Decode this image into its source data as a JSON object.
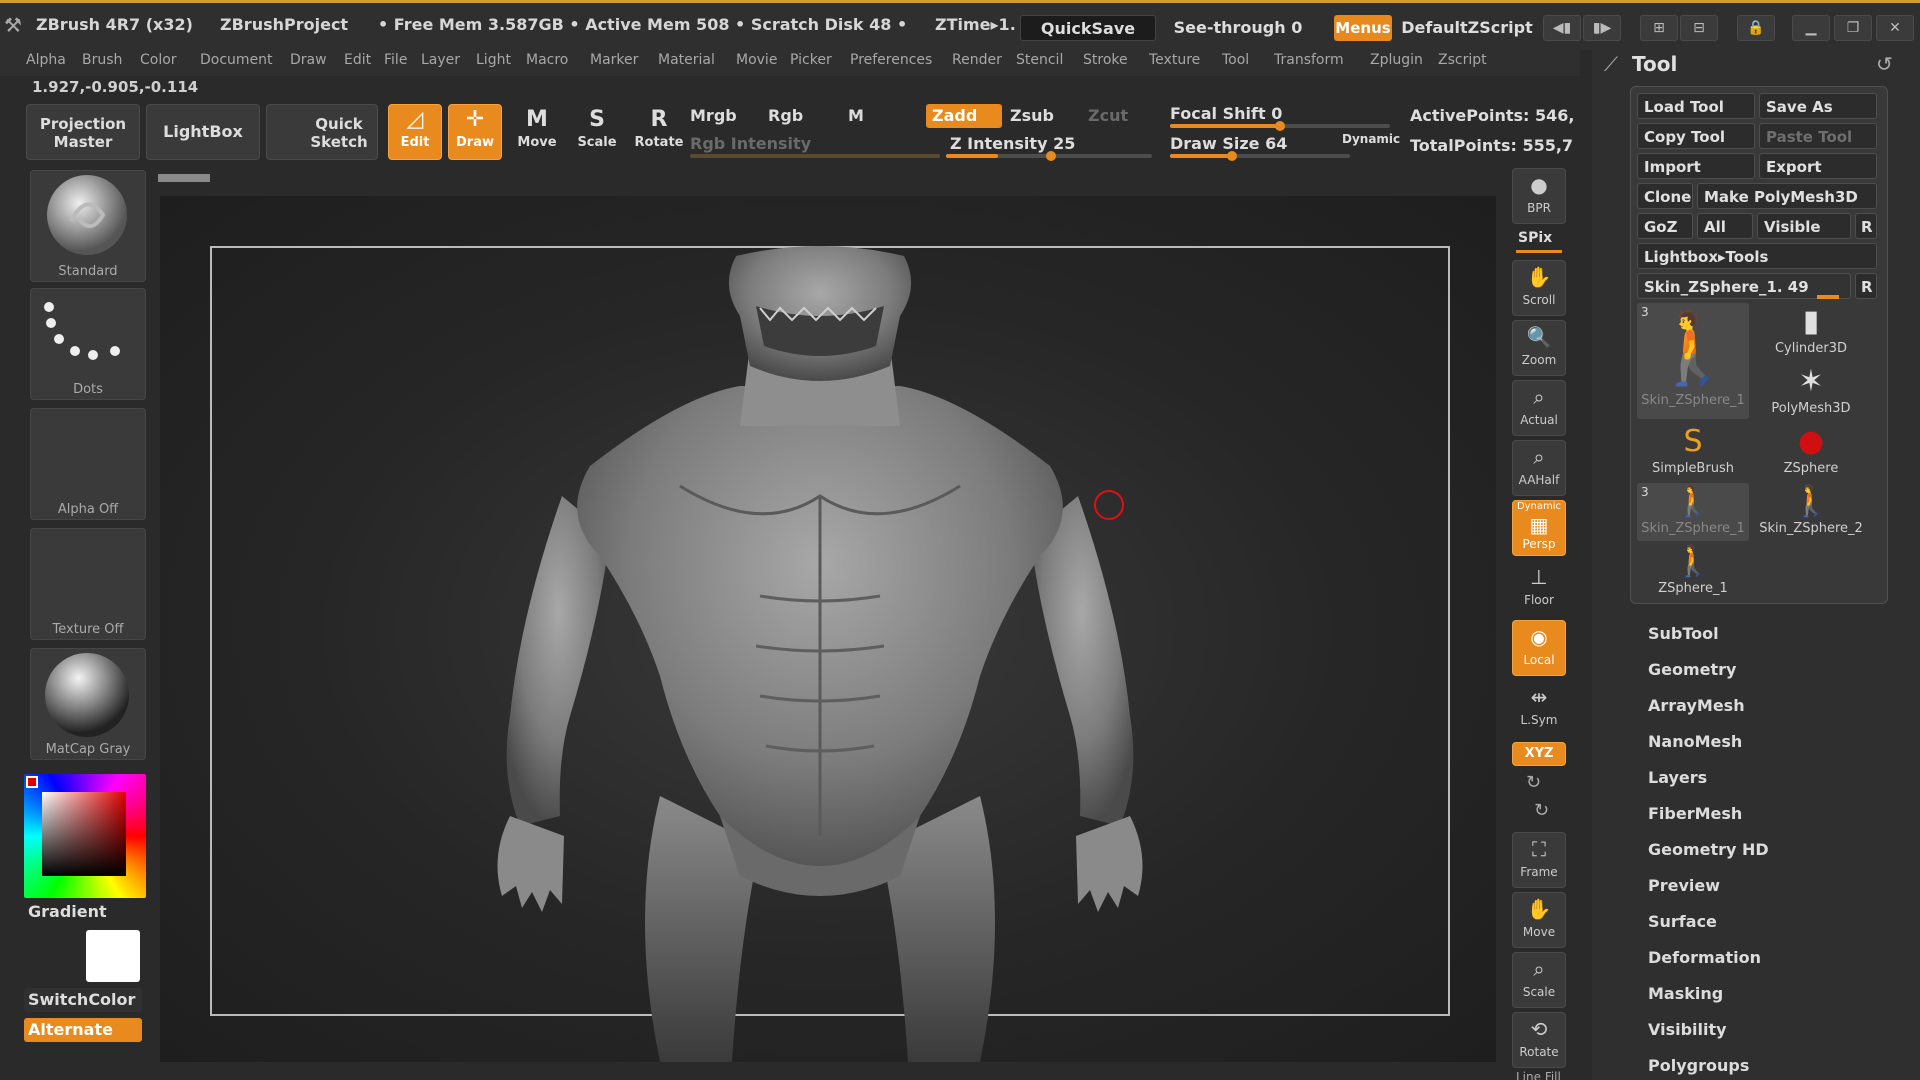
{
  "titlebar": {
    "app": "ZBrush 4R7 (x32)",
    "project": "ZBrushProject",
    "status": "• Free Mem 3.587GB • Active Mem 508 • Scratch Disk 48 •",
    "ztime": "ZTime▸1.",
    "quicksave": "QuickSave",
    "see_through": "See-through  0",
    "menus": "Menus",
    "default_zscript": "DefaultZScript"
  },
  "menubar": [
    "Alpha",
    "Brush",
    "Color",
    "Document",
    "Draw",
    "Edit",
    "File",
    "Layer",
    "Light",
    "Macro",
    "Marker",
    "Material",
    "Movie",
    "Picker",
    "Preferences",
    "Render",
    "Stencil",
    "Stroke",
    "Texture",
    "Tool",
    "Transform",
    "Zplugin",
    "Zscript"
  ],
  "coords": "1.927,-0.905,-0.114",
  "shelf": {
    "projection_master": "Projection Master",
    "lightbox": "LightBox",
    "quick_sketch": "Quick Sketch",
    "edit": "Edit",
    "draw": "Draw",
    "move": "Move",
    "scale": "Scale",
    "rotate": "Rotate",
    "mrgb": "Mrgb",
    "rgb": "Rgb",
    "m": "M",
    "rgb_intensity": "Rgb Intensity",
    "zadd": "Zadd",
    "zsub": "Zsub",
    "zcut": "Zcut",
    "z_intensity": "Z Intensity 25",
    "focal_shift": "Focal Shift 0",
    "draw_size": "Draw Size 64",
    "dynamic": "Dynamic",
    "active_points": "ActivePoints: 546,",
    "total_points": "TotalPoints: 555,7"
  },
  "left": {
    "brush": "Standard",
    "stroke": "Dots",
    "alpha": "Alpha Off",
    "texture": "Texture Off",
    "material": "MatCap Gray",
    "gradient": "Gradient",
    "switch_color": "SwitchColor",
    "alternate": "Alternate"
  },
  "right": {
    "bpr": "BPR",
    "spix": "SPix",
    "scroll": "Scroll",
    "zoom": "Zoom",
    "actual": "Actual",
    "aahalf": "AAHalf",
    "dynamic": "Dynamic",
    "persp": "Persp",
    "floor": "Floor",
    "local": "Local",
    "lsym": "L.Sym",
    "xyz": "XYZ",
    "frame": "Frame",
    "move": "Move",
    "scale": "Scale",
    "rotate": "Rotate",
    "line_fill": "Line Fill"
  },
  "tool": {
    "title": "Tool",
    "load_tool": "Load Tool",
    "save_as": "Save As",
    "copy_tool": "Copy Tool",
    "paste_tool": "Paste Tool",
    "import": "Import",
    "export": "Export",
    "clone": "Clone",
    "make_polymesh": "Make PolyMesh3D",
    "goz": "GoZ",
    "all": "All",
    "visible": "Visible",
    "r": "R",
    "lightbox_tools": "Lightbox▸Tools",
    "current_tool": "Skin_ZSphere_1. 49",
    "thumbs": [
      {
        "label": "Skin_ZSphere_1",
        "badge": "3"
      },
      {
        "label": "Cylinder3D"
      },
      {
        "label": "PolyMesh3D"
      },
      {
        "label": "SimpleBrush"
      },
      {
        "label": "ZSphere"
      },
      {
        "label": "Skin_ZSphere_1",
        "badge": "3"
      },
      {
        "label": "Skin_ZSphere_2"
      },
      {
        "label": "ZSphere_1"
      }
    ],
    "subpalettes": [
      "SubTool",
      "Geometry",
      "ArrayMesh",
      "NanoMesh",
      "Layers",
      "FiberMesh",
      "Geometry HD",
      "Preview",
      "Surface",
      "Deformation",
      "Masking",
      "Visibility",
      "Polygroups"
    ]
  },
  "colors": {
    "accent": "#e98a1e",
    "panel": "#2f2f2f",
    "primary_color": "#e00000",
    "secondary_color": "#ffffff"
  }
}
